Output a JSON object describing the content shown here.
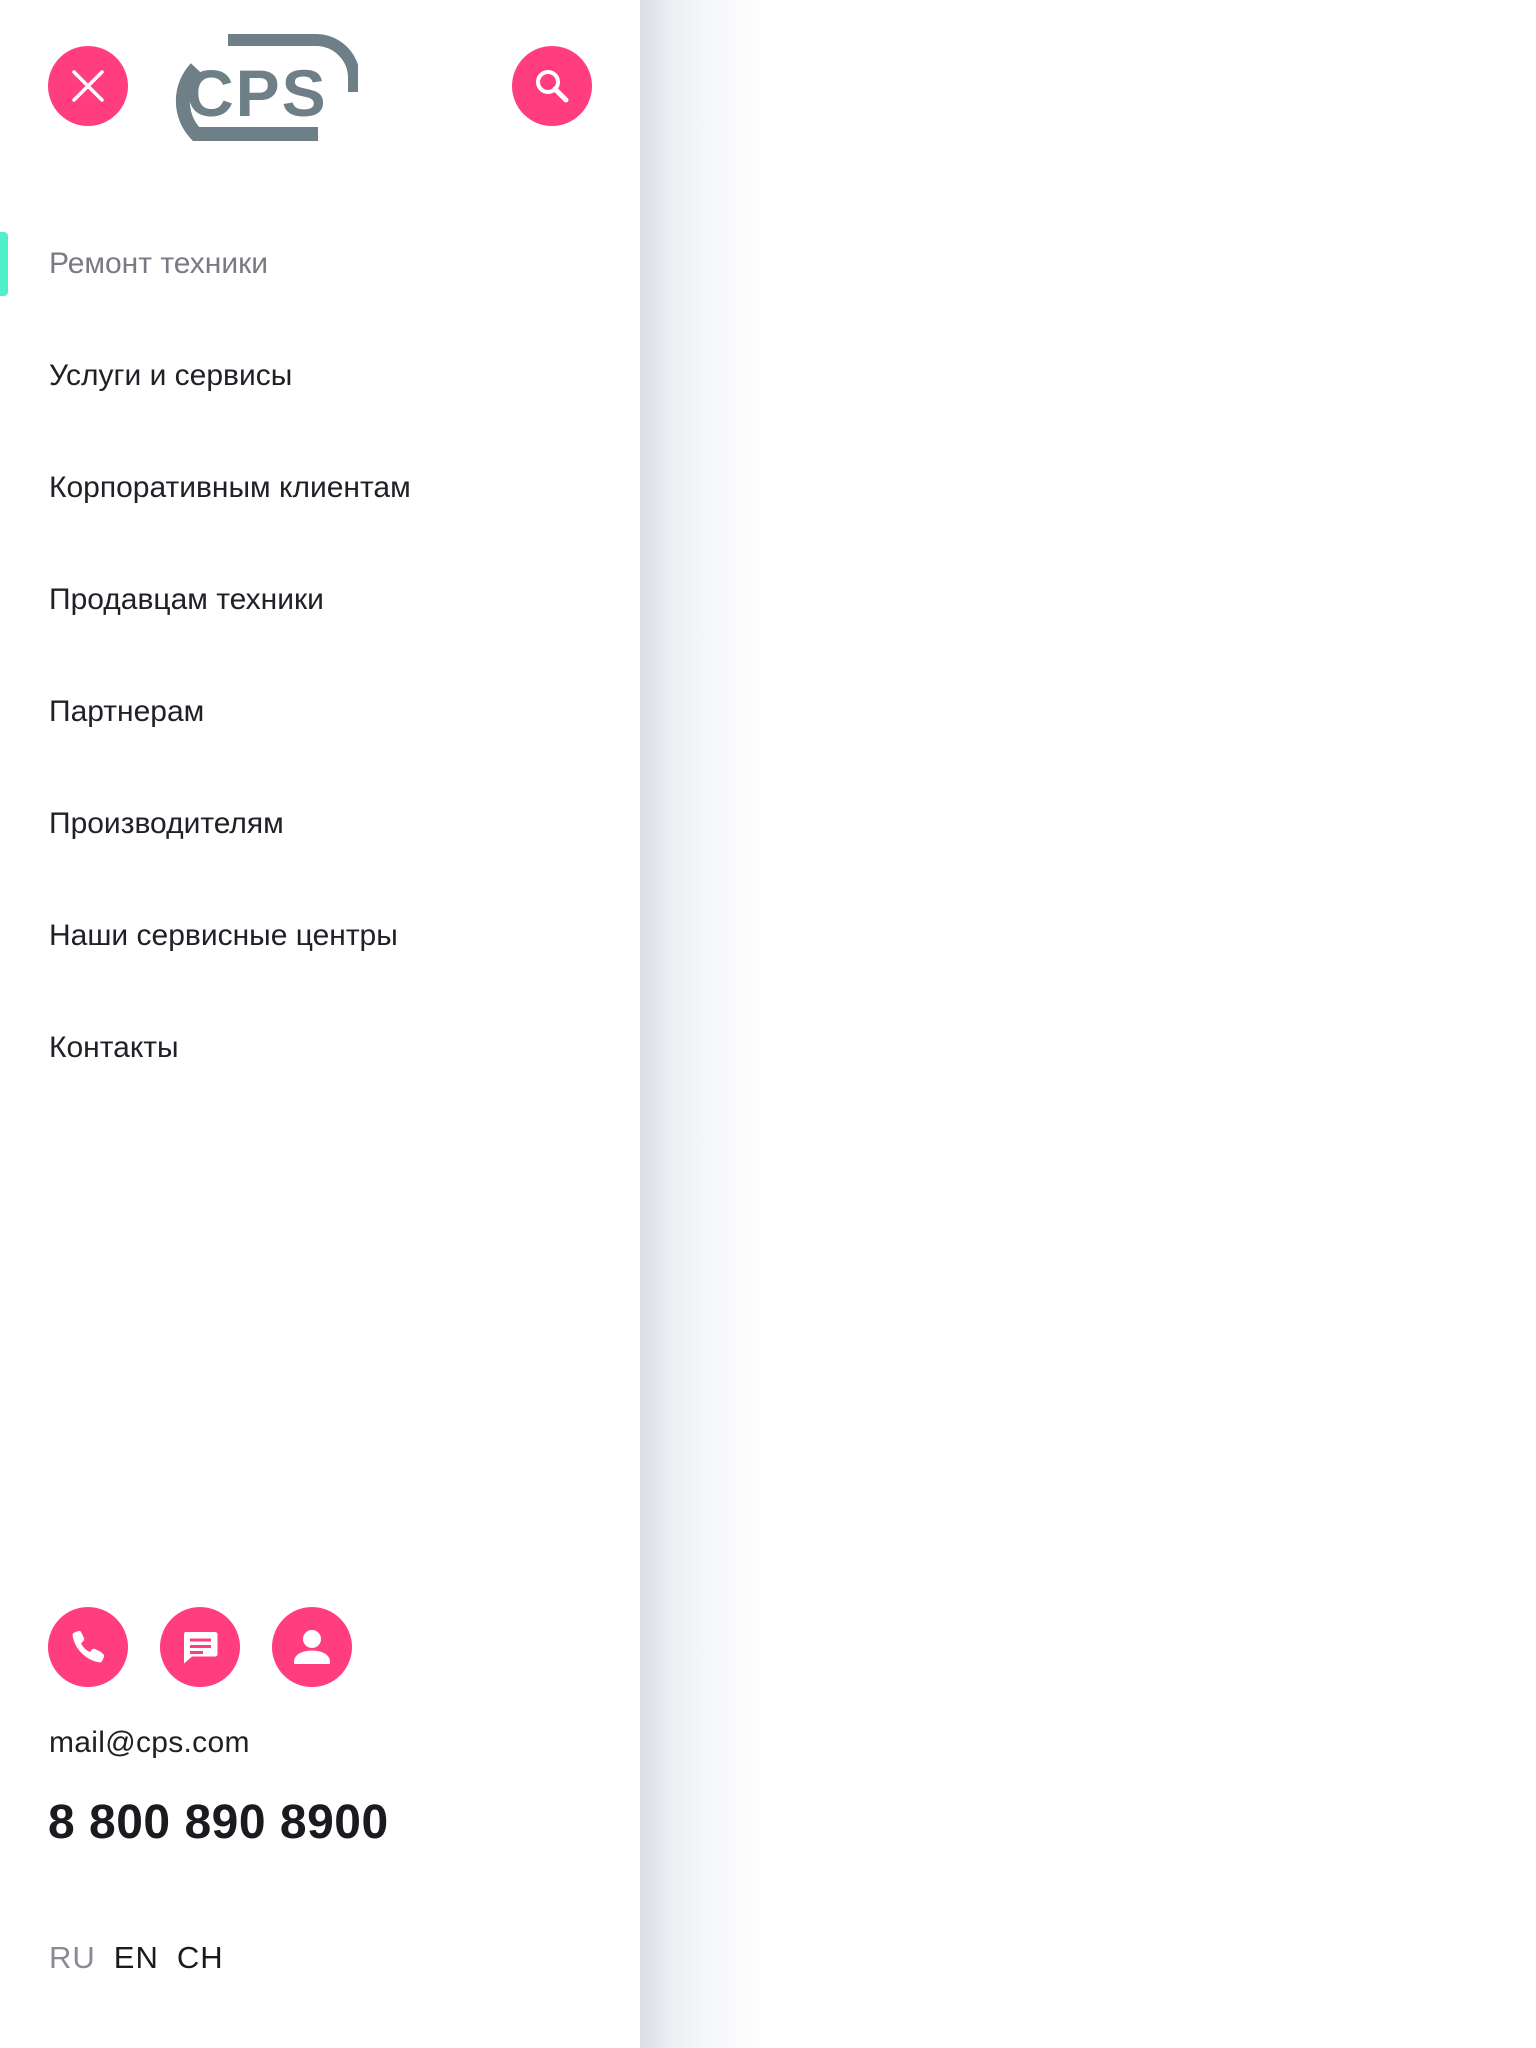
{
  "header": {
    "close_icon": "close-icon",
    "search_icon": "search-icon",
    "logo_text": "CPS"
  },
  "nav": {
    "items": [
      {
        "label": "Ремонт техники",
        "active": true
      },
      {
        "label": "Услуги и сервисы",
        "active": false
      },
      {
        "label": "Корпоративным клиентам",
        "active": false
      },
      {
        "label": "Продавцам техники",
        "active": false
      },
      {
        "label": "Партнерам",
        "active": false
      },
      {
        "label": "Производителям",
        "active": false
      },
      {
        "label": "Наши сервисные центры",
        "active": false
      },
      {
        "label": "Контакты",
        "active": false
      }
    ]
  },
  "contacts": {
    "icons": [
      "phone-icon",
      "chat-icon",
      "user-icon"
    ],
    "email": "mail@cps.com",
    "phone": "8 800 890 8900"
  },
  "languages": [
    {
      "code": "RU",
      "active": true
    },
    {
      "code": "EN",
      "active": false
    },
    {
      "code": "CH",
      "active": false
    }
  ],
  "colors": {
    "accent": "#ff3d7f",
    "active_marker": "#4ef0c8",
    "logo": "#6f7f87",
    "text": "#202026",
    "muted_text": "#7a7a82"
  }
}
